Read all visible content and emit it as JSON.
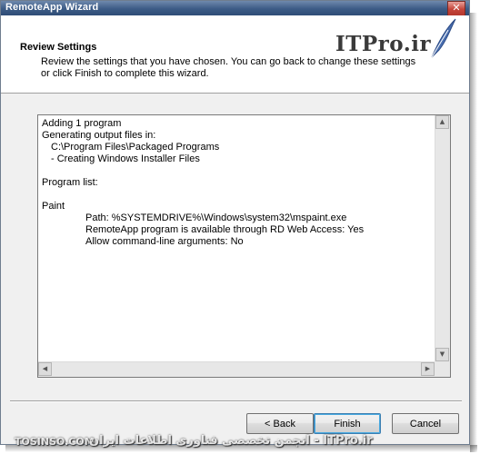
{
  "window": {
    "title": "RemoteApp Wizard",
    "close_glyph": "✕"
  },
  "header": {
    "title": "Review Settings",
    "description": "Review the settings that you have chosen. You can go back to change these settings or click Finish to complete this wizard.",
    "brand": "ITPro.ir",
    "brand_icon": "feather-icon"
  },
  "summary": {
    "lines": [
      {
        "text": "Adding 1 program",
        "indent": 0
      },
      {
        "text": "Generating output files in:",
        "indent": 0
      },
      {
        "text": "C:\\Program Files\\Packaged Programs",
        "indent": 1
      },
      {
        "text": "- Creating Windows Installer Files",
        "indent": 1
      },
      {
        "text": "",
        "indent": 0
      },
      {
        "text": "Program list:",
        "indent": 0
      },
      {
        "text": "",
        "indent": 0
      },
      {
        "text": "Paint",
        "indent": 0
      },
      {
        "text": "Path: %SYSTEMDRIVE%\\Windows\\system32\\mspaint.exe",
        "indent": 2
      },
      {
        "text": "RemoteApp program is available through RD Web Access: Yes",
        "indent": 2
      },
      {
        "text": "Allow command-line arguments: No",
        "indent": 2
      }
    ]
  },
  "buttons": {
    "back": "< Back",
    "finish": "Finish",
    "cancel": "Cancel"
  },
  "watermark": {
    "left": "TOSINSO.COM",
    "right": "انجمن تخصصی فناوری اطلاعات ایران - ITPro.ir"
  },
  "colors": {
    "titlebar": "#3c5b86",
    "default_button_border": "#3c7fb1"
  }
}
